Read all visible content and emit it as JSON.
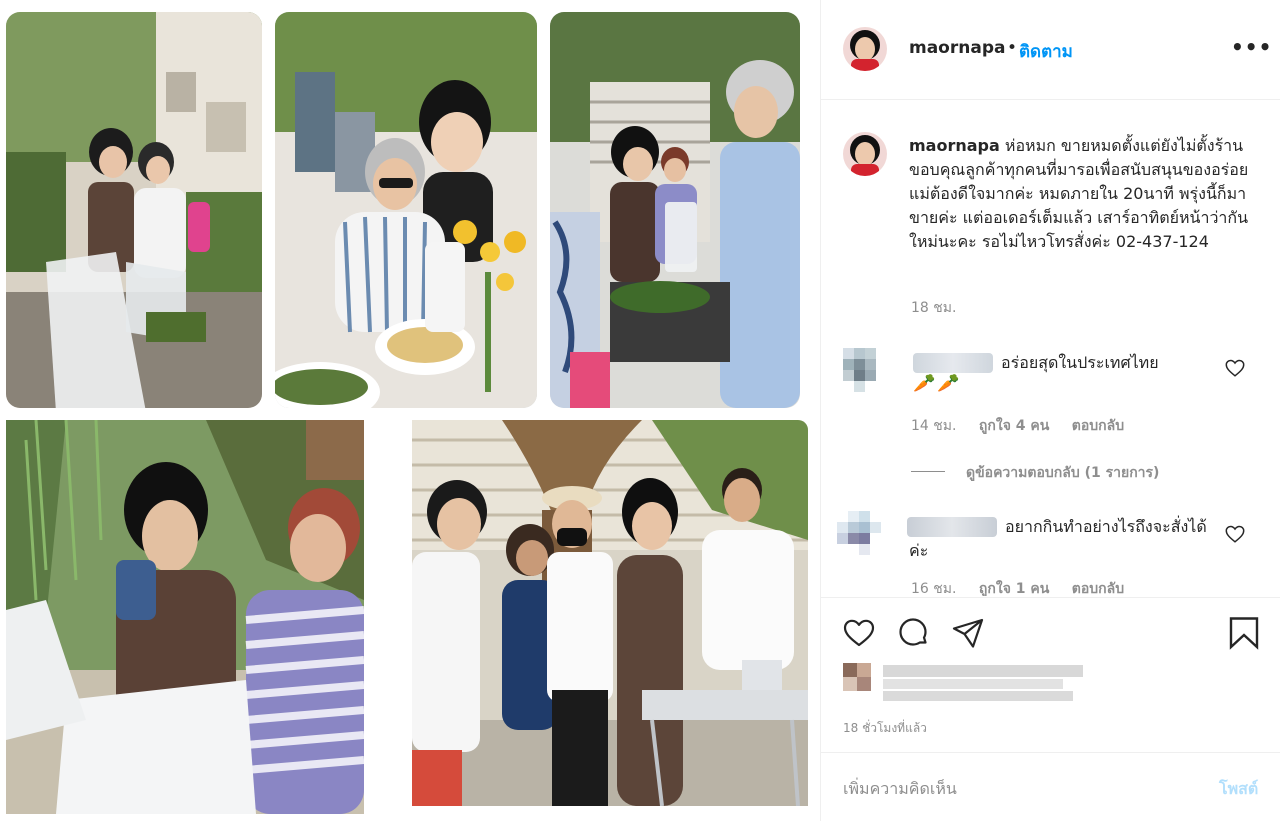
{
  "header": {
    "username": "maornapa",
    "separator": "•",
    "follow_label": "ติดตาม",
    "more_icon": "more-horizontal-icon",
    "more_label": "•••"
  },
  "caption": {
    "username": "maornapa",
    "text": "ห่อหมก ขายหมดตั้งแต่ยังไม่ตั้งร้าน ขอบคุณลูกค้าทุกคนที่มารอเพื่อสนับสนุนของอร่อย แม่ต้องดีใจมากค่ะ หมดภายใน 20นาที พรุ่งนี้ก็มาขายค่ะ แต่ออเดอร์เต็มแล้ว เสาร์อาทิตย์หน้าว่ากันใหม่นะคะ รอไม่ไหวโทรสั่งค่ะ 02-437-124",
    "time": "18 ชม."
  },
  "comments": [
    {
      "text": "อร่อยสุดในประเทศไทย",
      "emoji": "🥕🥕",
      "time": "14 ชม.",
      "likes": "ถูกใจ 4 คน",
      "reply": "ตอบกลับ",
      "view_replies": "ดูข้อความตอบกลับ (1 รายการ)"
    },
    {
      "text": "อยากกินทำอย่างไรถึงจะสั่งได้ค่ะ",
      "time": "16 ชม.",
      "likes": "ถูกใจ 1 คน",
      "reply": "ตอบกลับ"
    }
  ],
  "actions": {
    "icons": [
      "heart-icon",
      "comment-icon",
      "share-icon",
      "bookmark-icon"
    ],
    "post_time": "18 ชั่วโมงที่แล้ว"
  },
  "add_comment": {
    "placeholder": "เพิ่มความคิดเห็น",
    "post_label": "โพสต์"
  },
  "colors": {
    "link_blue": "#0095f6",
    "post_disabled": "#b2dffc",
    "meta_gray": "#8e8e8e",
    "text": "#262626",
    "divider": "#efefef"
  }
}
